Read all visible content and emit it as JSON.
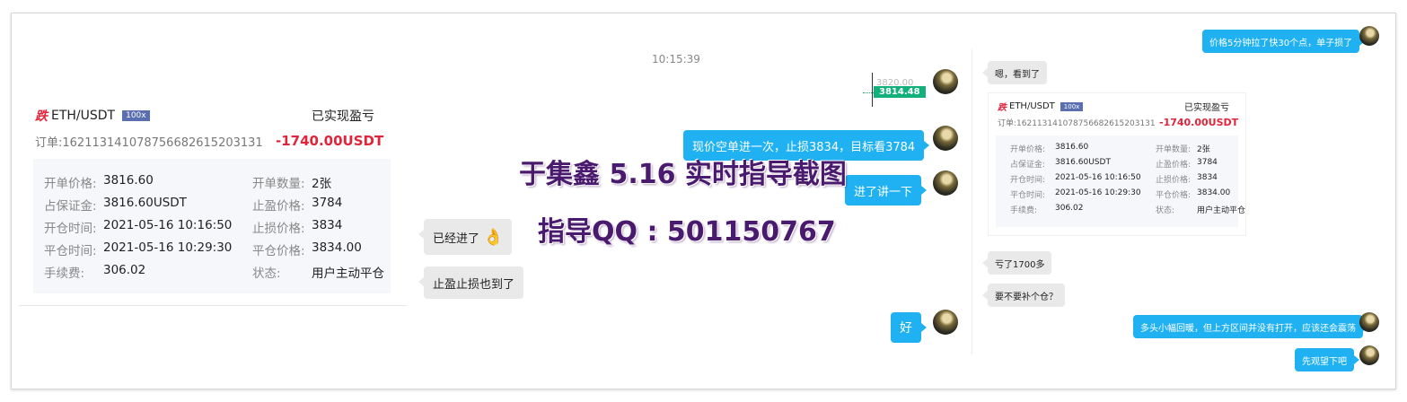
{
  "timestamp": "10:15:39",
  "left_card": {
    "side_label": "跌",
    "pair": "ETH/USDT",
    "leverage": "100x",
    "realized_label": "已实现盈亏",
    "order_label": "订单:1621131410787566826152031​31",
    "pnl": "-1740.00USDT",
    "rows": [
      {
        "l1": "开单价格:",
        "v1": "3816.60",
        "l2": "开单数量:",
        "v2": "2张"
      },
      {
        "l1": "占保证金:",
        "v1": "3816.60USDT",
        "l2": "止盈价格:",
        "v2": "3784"
      },
      {
        "l1": "开仓时间:",
        "v1": "2021-05-16 10:16:50",
        "l2": "止损价格:",
        "v2": "3834"
      },
      {
        "l1": "平仓时间:",
        "v1": "2021-05-16 10:29:30",
        "l2": "平仓价格:",
        "v2": "3834.00"
      },
      {
        "l1": "手续费:",
        "v1": "306.02",
        "l2": "状态:",
        "v2": "用户主动平仓"
      }
    ]
  },
  "mini_chart": {
    "faded_price": "3820.00",
    "price": "3814.48"
  },
  "messages_middle": {
    "m1": "现价空单进一次，止损3834，目标看3784",
    "m2": "进了讲一下",
    "m3": "已经进了",
    "m4": "止盈止损也到了",
    "m5": "好"
  },
  "watermark": {
    "line1": "于集鑫 5.16 实时指导截图",
    "line2": "指导QQ : 501150767"
  },
  "right_chat": {
    "r1": "价格5分钟拉了快30个点，单子损了",
    "r2": "嗯，看到了",
    "r3": "亏了1700多",
    "r4": "要不要补个仓？",
    "r5": "多头小幅回暖，但上方区间并没有打开，应该还会震荡",
    "r6": "先观望下吧"
  },
  "colors": {
    "accent": "#1fb1f2",
    "loss": "#e0243a",
    "bubble_gray": "#e9e9e9",
    "watermark": "#4a1a6e"
  }
}
